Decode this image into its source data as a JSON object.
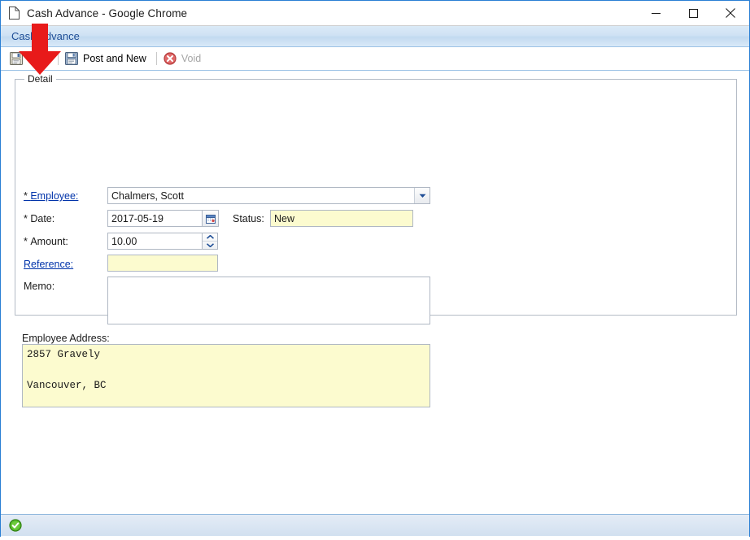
{
  "window": {
    "title": "Cash Advance - Google Chrome",
    "icon": "document-icon",
    "controls": {
      "minimize": "minimize-icon",
      "maximize": "maximize-icon",
      "close": "close-icon"
    }
  },
  "header": {
    "title": "Cash Advance"
  },
  "toolbar": {
    "items": [
      {
        "label": "Post",
        "icon": "save-disk-icon",
        "enabled": true
      },
      {
        "label": "Post and New",
        "icon": "save-and-new-icon",
        "enabled": true
      },
      {
        "label": "Void",
        "icon": "void-cancel-icon",
        "enabled": false
      }
    ]
  },
  "detail": {
    "legend": "Detail",
    "fields": {
      "employee": {
        "label": "Employee:",
        "required_marker": "*",
        "is_link": true,
        "value": "Chalmers, Scott",
        "dropdown_icon": "chevron-down-icon"
      },
      "date": {
        "label": "Date:",
        "required_marker": "*",
        "is_link": false,
        "value": "2017-05-19",
        "picker_icon": "calendar-icon"
      },
      "status": {
        "label": "Status:",
        "value": "New",
        "readonly": true
      },
      "amount": {
        "label": "Amount:",
        "required_marker": "*",
        "is_link": false,
        "value": "10.00",
        "spinner_up_icon": "chevron-up-icon",
        "spinner_down_icon": "chevron-down-icon"
      },
      "reference": {
        "label": "Reference:",
        "is_link": true,
        "value": "",
        "placeholder": ""
      },
      "memo": {
        "label": "Memo:",
        "value": "",
        "placeholder": ""
      },
      "employee_address": {
        "label": "Employee Address:",
        "value": "2857 Gravely\n\nVancouver, BC",
        "readonly": true
      }
    }
  },
  "statusbar": {
    "icon": "status-ok-check-icon",
    "text": ""
  },
  "annotation": {
    "arrow": "red-down-arrow",
    "points_at": "Post",
    "color": "#e81a1a"
  },
  "colors": {
    "accent_blue": "#2a7fd4",
    "header_text": "#1f4e96",
    "link": "#0033aa",
    "readonly_yellow": "#fcfbcf",
    "annotation_red": "#e81a1a",
    "status_ok_green": "#4caf28"
  }
}
